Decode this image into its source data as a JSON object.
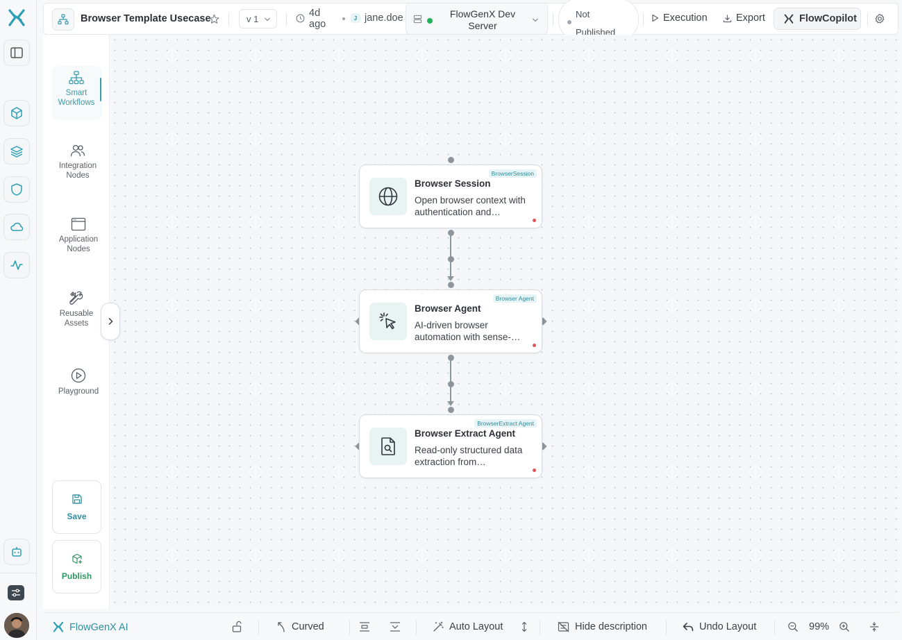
{
  "header": {
    "workflow_title": "Browser Template Usecase",
    "version": "v 1",
    "updated_ago": "4d ago",
    "user_initial": "J",
    "user": "jane.doe",
    "server_name": "FlowGenX Dev Server",
    "publish_status": "Not Published",
    "execution_label": "Execution",
    "export_label": "Export",
    "copilot_label": "FlowCopilot"
  },
  "sidebar": {
    "items": [
      {
        "label": "Smart Workflows",
        "icon": "sitemap-icon",
        "active": true
      },
      {
        "label": "Integration Nodes",
        "icon": "users-icon"
      },
      {
        "label": "Application Nodes",
        "icon": "window-icon"
      },
      {
        "label": "Reusable Assets",
        "icon": "tools-icon"
      },
      {
        "label": "Playground",
        "icon": "play-circle-icon"
      }
    ],
    "save_label": "Save",
    "publish_label": "Publish"
  },
  "nodes": [
    {
      "title": "Browser Session",
      "description": "Open browser context with authentication and…",
      "tag": "BrowserSession",
      "icon": "globe-icon"
    },
    {
      "title": "Browser Agent",
      "description": "AI-driven browser automation with sense-…",
      "tag": "Browser Agent",
      "icon": "pointer-click-icon"
    },
    {
      "title": "Browser Extract Agent",
      "description": "Read-only structured data extraction from…",
      "tag": "BrowserExtract Agent",
      "icon": "file-search-icon"
    }
  ],
  "bottombar": {
    "ai_label": "FlowGenX AI",
    "edge_style": "Curved",
    "auto_layout": "Auto Layout",
    "hide_description": "Hide description",
    "undo_layout": "Undo Layout",
    "zoom": "99%"
  },
  "colors": {
    "accent": "#3a9aaa",
    "publish_green": "#2d9660",
    "server_online": "#22b35a",
    "node_status_dot": "#e05252"
  }
}
